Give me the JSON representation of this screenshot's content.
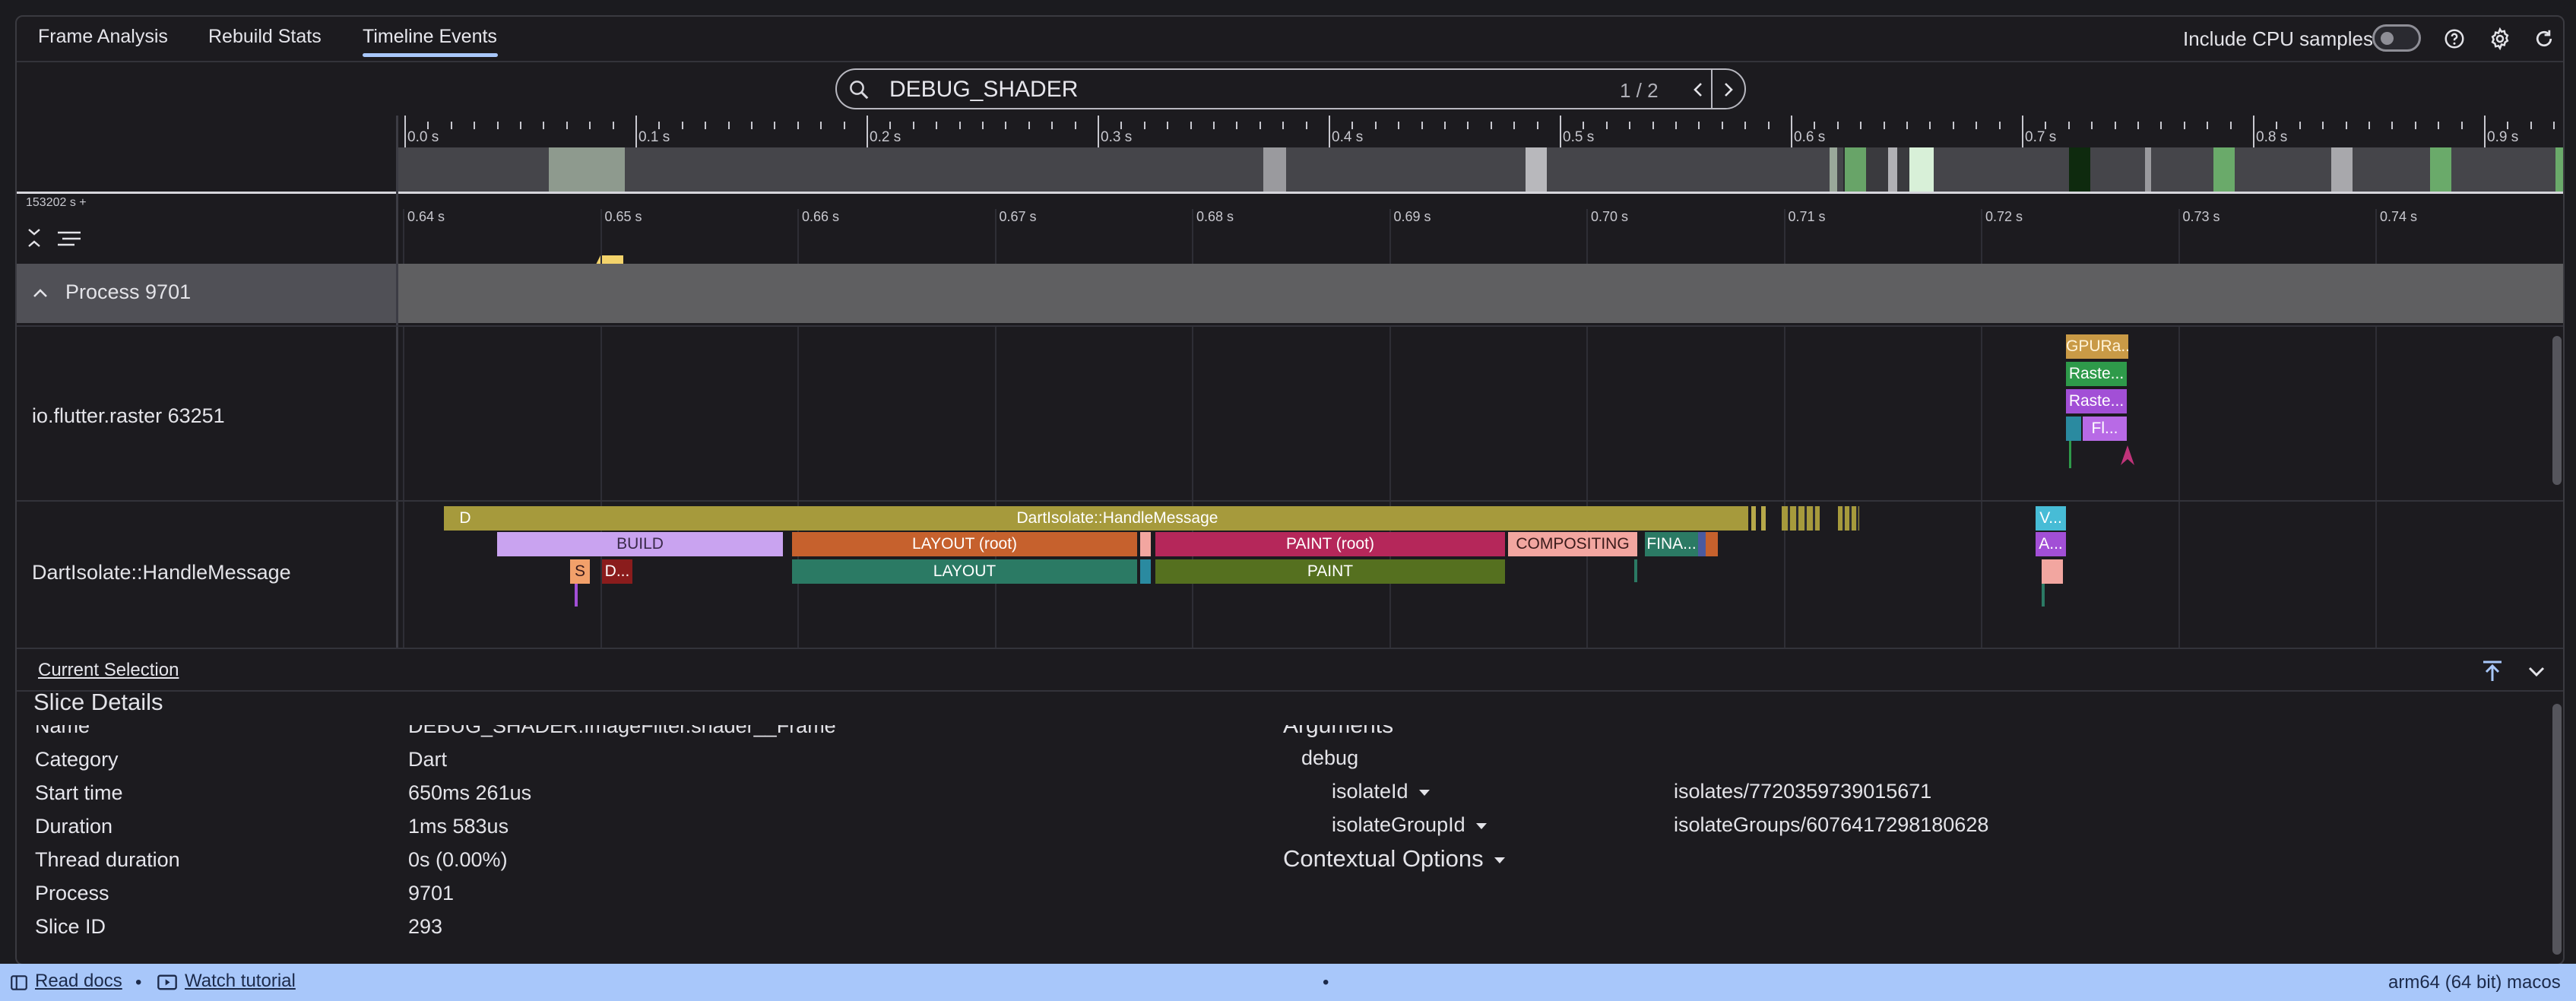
{
  "tabs": [
    {
      "label": "Frame Analysis"
    },
    {
      "label": "Rebuild Stats"
    },
    {
      "label": "Timeline Events"
    }
  ],
  "header": {
    "cpu_label": "Include CPU samples"
  },
  "search": {
    "query": "DEBUG_SHADER",
    "count": "1 / 2"
  },
  "overview_ticks": [
    "0.0 s",
    "0.1 s",
    "0.2 s",
    "0.3 s",
    "0.4 s",
    "0.5 s",
    "0.6 s",
    "0.7 s",
    "0.8 s",
    "0.9 s"
  ],
  "timestamp_origin": "153202 s +",
  "detail_ticks": [
    "0.64 s",
    "0.65 s",
    "0.66 s",
    "0.67 s",
    "0.68 s",
    "0.69 s",
    "0.70 s",
    "0.71 s",
    "0.72 s",
    "0.73 s",
    "0.74 s"
  ],
  "process": {
    "label": "Process 9701"
  },
  "threads": [
    {
      "label": "io.flutter.raster 63251"
    },
    {
      "label": "DartIsolate::HandleMessage"
    }
  ],
  "events": {
    "d": "D",
    "handle_message": "DartIsolate::HandleMessage",
    "build": "BUILD",
    "layout_root": "LAYOUT (root)",
    "paint_root": "PAINT (root)",
    "compositing": "COMPOSITING",
    "finalize": "FINA...",
    "layout": "LAYOUT",
    "paint": "PAINT",
    "s": "S",
    "d2": "D...",
    "gpu": "GPURa...",
    "raster1": "Raste...",
    "raster2": "Raste...",
    "fl": "Fl...",
    "v": "V...",
    "a": "A..."
  },
  "selection": {
    "tab_label": "Current Selection",
    "title": "Slice Details",
    "rows": [
      {
        "key": "Name",
        "value": "DEBUG_SHADER.ImageFilter.shader__Frame"
      },
      {
        "key": "Category",
        "value": "Dart"
      },
      {
        "key": "Start time",
        "value": "650ms 261us"
      },
      {
        "key": "Duration",
        "value": "1ms 583us"
      },
      {
        "key": "Thread duration",
        "value": "0s (0.00%)"
      },
      {
        "key": "Process",
        "value": "9701"
      },
      {
        "key": "Slice ID",
        "value": "293"
      }
    ],
    "arguments": {
      "title": "Arguments",
      "debug": "debug",
      "isolate_id_key": "isolateId",
      "isolate_id_value": "isolates/7720359739015671",
      "isolate_group_key": "isolateGroupId",
      "isolate_group_value": "isolateGroups/6076417298180628",
      "contextual": "Contextual Options"
    }
  },
  "footer": {
    "read_docs": "Read docs",
    "separator": "•",
    "watch_tutorial": "Watch tutorial",
    "center_dot": "•",
    "platform": "arm64 (64 bit) macos"
  },
  "colors": {
    "accent": "#a8c7fa",
    "handle_message": "#a69a3c",
    "build": "#c9a3f0",
    "layout": "#c6612d",
    "paint": "#b5275a",
    "compositing": "#f2a6a0",
    "layout_green": "#2b7a64",
    "paint_green": "#55701f"
  }
}
